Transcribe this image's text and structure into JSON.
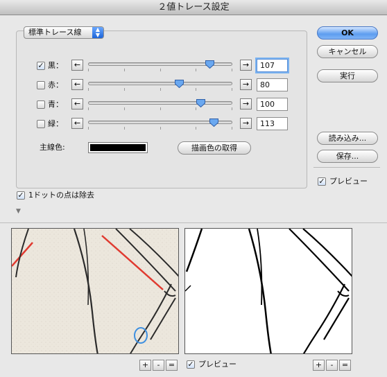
{
  "window": {
    "title": "２値トレース設定"
  },
  "preset": {
    "selected": "標準トレース線"
  },
  "channels": [
    {
      "id": "black",
      "label": "黒：",
      "checked": true,
      "value": "107",
      "level": 0.84
    },
    {
      "id": "red",
      "label": "赤：",
      "checked": false,
      "value": "80",
      "level": 0.63
    },
    {
      "id": "blue",
      "label": "青：",
      "checked": false,
      "value": "100",
      "level": 0.78
    },
    {
      "id": "green",
      "label": "緑：",
      "checked": false,
      "value": "113",
      "level": 0.87
    }
  ],
  "slider_arrows": {
    "left": "←",
    "right": "→"
  },
  "main_line": {
    "label": "主線色:",
    "color": "#000000"
  },
  "get_color_button": "描画色の取得",
  "buttons": {
    "ok": "OK",
    "cancel": "キャンセル",
    "run": "実行",
    "load": "読み込み...",
    "save": "保存..."
  },
  "preview_right": {
    "label": "プレビュー",
    "checked": true
  },
  "remove_dots": {
    "label": "1ドットの点は除去",
    "checked": true
  },
  "preview_bottom": {
    "label": "プレビュー",
    "checked": true
  },
  "zoom_buttons": [
    "+",
    "-",
    "="
  ],
  "colors": {
    "accent": "#5d9df0",
    "red_line": "#e03a30",
    "blue_circle": "#3d8fe0"
  }
}
